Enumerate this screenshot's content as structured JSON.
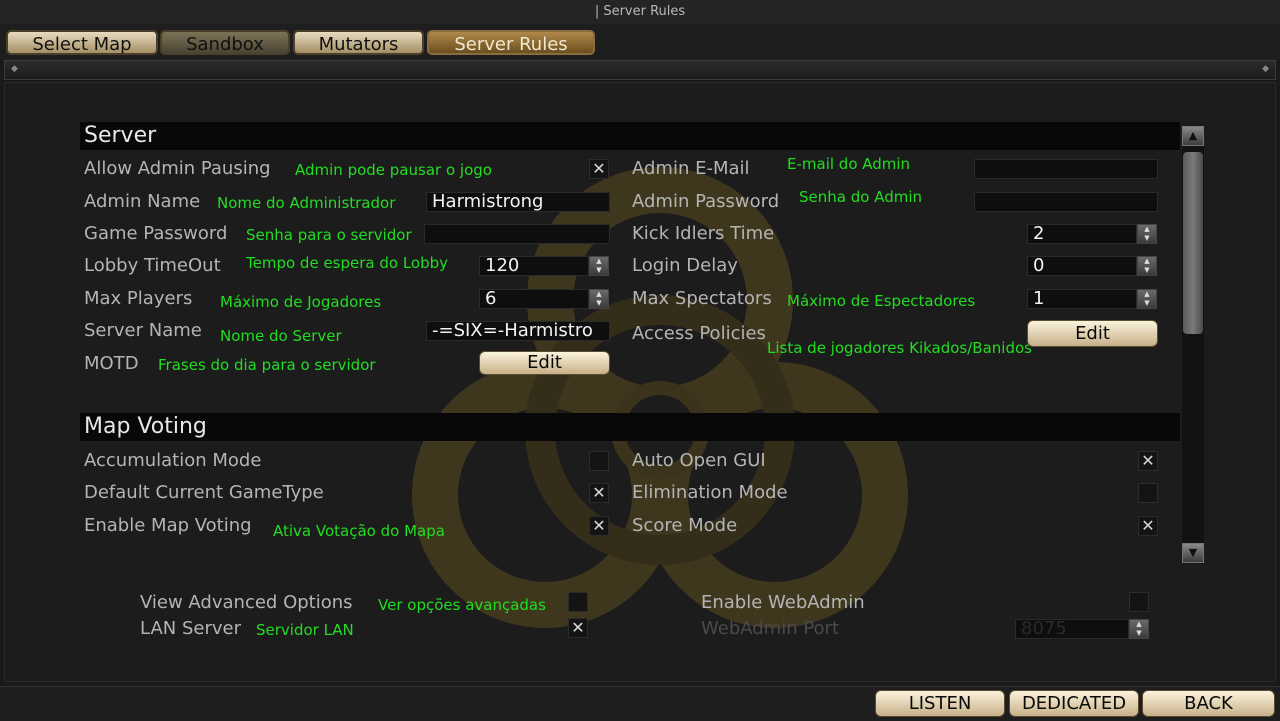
{
  "window": {
    "title": "| Server Rules"
  },
  "tabs": [
    {
      "label": "Select Map",
      "state": "normal"
    },
    {
      "label": "Sandbox",
      "state": "disabled"
    },
    {
      "label": "Mutators",
      "state": "normal"
    },
    {
      "label": "Server Rules",
      "state": "active"
    }
  ],
  "server": {
    "heading": "Server",
    "allow_admin_pausing": {
      "label": "Allow Admin Pausing",
      "note": "Admin pode pausar o jogo",
      "checked": true
    },
    "admin_email": {
      "label": "Admin E-Mail",
      "note": "E-mail do Admin",
      "value": ""
    },
    "admin_name": {
      "label": "Admin Name",
      "note": "Nome do Administrador",
      "value": "Harmistrong"
    },
    "admin_password": {
      "label": "Admin Password",
      "note": "Senha do Admin",
      "value": ""
    },
    "game_password": {
      "label": "Game Password",
      "note": "Senha para o servidor",
      "value": ""
    },
    "kick_idlers_time": {
      "label": "Kick Idlers Time",
      "value": "2"
    },
    "lobby_timeout": {
      "label": "Lobby TimeOut",
      "note": "Tempo de espera do Lobby",
      "value": "120"
    },
    "login_delay": {
      "label": "Login Delay",
      "value": "0"
    },
    "max_players": {
      "label": "Max Players",
      "note": "Máximo de Jogadores",
      "value": "6"
    },
    "max_spectators": {
      "label": "Max Spectators",
      "note": "Máximo de Espectadores",
      "value": "1"
    },
    "server_name": {
      "label": "Server Name",
      "note": "Nome do Server",
      "value": "-=SIX=-Harmistro"
    },
    "access_policies": {
      "label": "Access Policies",
      "note": "Lista de jogadores Kikados/Banidos",
      "button": "Edit"
    },
    "motd": {
      "label": "MOTD",
      "note": "Frases do dia para o servidor",
      "button": "Edit"
    }
  },
  "map_voting": {
    "heading": "Map Voting",
    "accumulation_mode": {
      "label": "Accumulation Mode",
      "checked": false
    },
    "auto_open_gui": {
      "label": "Auto Open GUI",
      "checked": true
    },
    "default_current_gametype": {
      "label": "Default Current GameType",
      "checked": true
    },
    "elimination_mode": {
      "label": "Elimination Mode",
      "checked": false
    },
    "enable_map_voting": {
      "label": "Enable Map Voting",
      "note": "Ativa Votação do Mapa",
      "checked": true
    },
    "score_mode": {
      "label": "Score Mode",
      "checked": true
    }
  },
  "options": {
    "view_advanced": {
      "label": "View Advanced Options",
      "note": "Ver opções avançadas",
      "checked": false
    },
    "lan_server": {
      "label": "LAN Server",
      "note": "Servidor LAN",
      "checked": true
    },
    "enable_webadmin": {
      "label": "Enable WebAdmin",
      "checked": false
    },
    "webadmin_port": {
      "label": "WebAdmin Port",
      "value": "8075",
      "enabled": false
    }
  },
  "footer": {
    "listen": "LISTEN",
    "dedicated": "DEDICATED",
    "back": "BACK"
  },
  "icons": {
    "check": "✕",
    "spin_up": "▲",
    "spin_down": "▼",
    "scroll_up": "▲",
    "scroll_down": "▼",
    "divider_knob": "◆"
  },
  "colors": {
    "note_green": "#22dd22",
    "active_tab": "#8a6d3c",
    "button_cream": "#fbf3dd"
  }
}
